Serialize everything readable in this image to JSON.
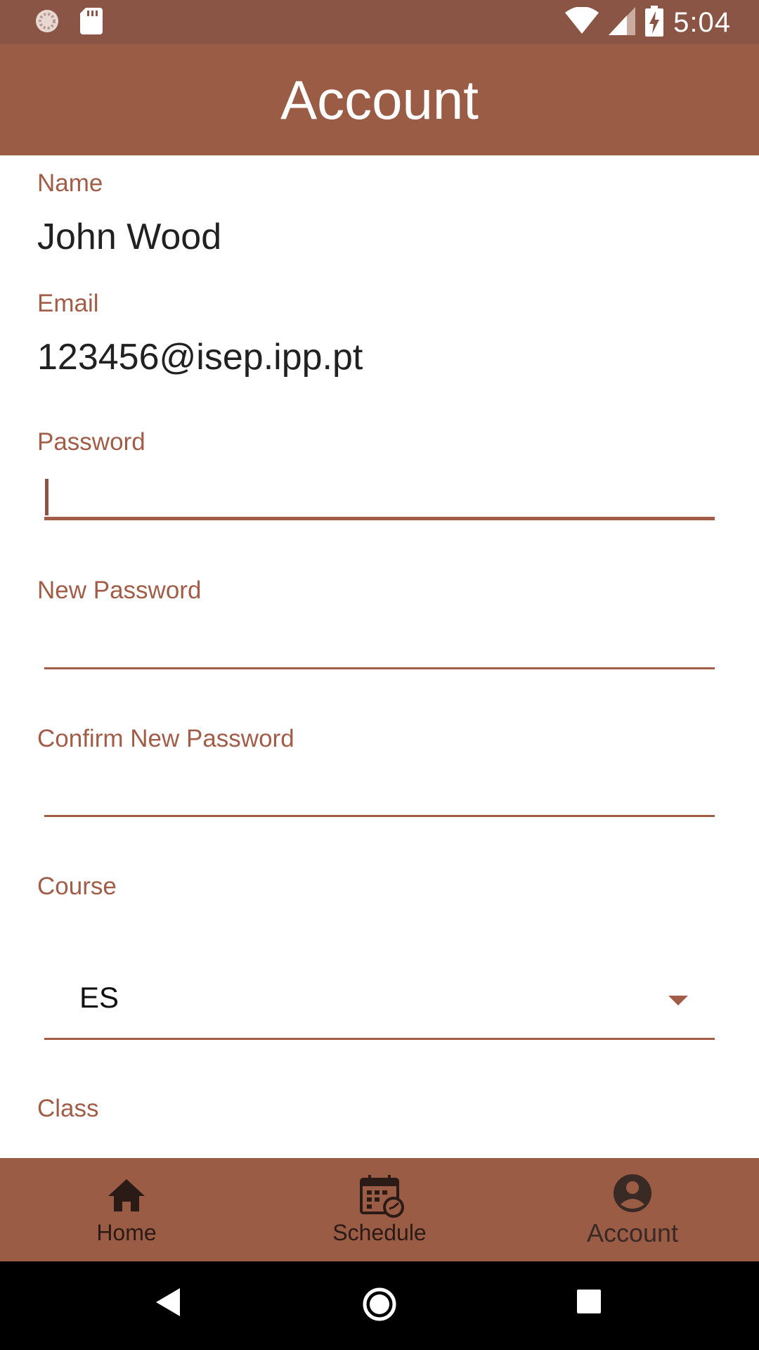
{
  "status_bar": {
    "time": "5:04",
    "icons": [
      "sync-icon",
      "sd-card-icon",
      "wifi-icon",
      "signal-icon",
      "battery-charging-icon"
    ]
  },
  "header": {
    "title": "Account"
  },
  "form": {
    "name_label": "Name",
    "name_value": "John Wood",
    "email_label": "Email",
    "email_value": "123456@isep.ipp.pt",
    "password_label": "Password",
    "password_value": "",
    "new_password_label": "New Password",
    "new_password_value": "",
    "confirm_password_label": "Confirm New Password",
    "confirm_password_value": "",
    "course_label": "Course",
    "course_selected": "ES",
    "class_label": "Class"
  },
  "bottom_nav": {
    "items": [
      {
        "label": "Home",
        "icon": "home-icon"
      },
      {
        "label": "Schedule",
        "icon": "schedule-icon"
      },
      {
        "label": "Account",
        "icon": "account-icon",
        "active": true
      }
    ]
  },
  "colors": {
    "status_bar": "#8a5544",
    "primary": "#9b5c45",
    "accent": "#a15d47"
  }
}
